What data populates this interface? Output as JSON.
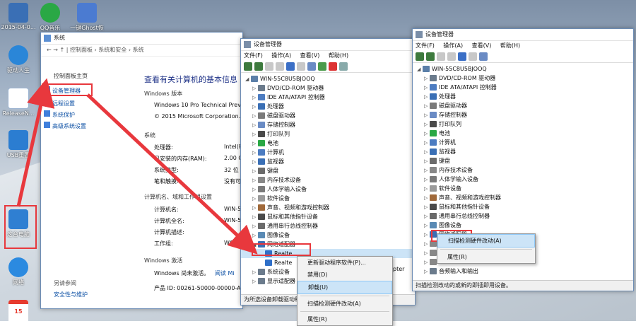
{
  "desktop": {
    "icons": [
      {
        "label": "2015-04-0...",
        "color": "#3a6fb5"
      },
      {
        "label": "QQ音乐",
        "color": "#28a745"
      },
      {
        "label": "一键Ghost恢复",
        "color": "#4b7bd1"
      },
      {
        "label": "驱动人生",
        "color": "#2a86d8"
      },
      {
        "label": "ReleaseN...",
        "color": "#9bb3d1"
      },
      {
        "label": "USB重置",
        "color": "#2b7dd1"
      },
      {
        "label": "这台电脑",
        "color": "#2f7fd2"
      },
      {
        "label": "网络",
        "color": "#2b8ae0"
      },
      {
        "label": "15",
        "color": "#e63b2e"
      }
    ]
  },
  "system_window": {
    "title": "系统",
    "breadcrumb": [
      "控制面板",
      "系统和安全",
      "系统"
    ],
    "left_links": {
      "home": "控制面板主页",
      "device_manager": "设备管理器",
      "remote": "远程设置",
      "protection": "系统保护",
      "advanced": "高级系统设置",
      "see_also": "另请参阅",
      "security": "安全性与维护"
    },
    "heading": "查看有关计算机的基本信息",
    "edition_label": "Windows 版本",
    "edition": "Windows 10 Pro Technical Previ",
    "copyright": "© 2015 Microsoft Corporation.",
    "system_section": "系统",
    "processor_label": "处理器:",
    "processor": "Intel(R",
    "memory_label": "已安装的内存(RAM):",
    "memory": "2.00 G",
    "type_label": "系统类型:",
    "type": "32 位",
    "pen_label": "笔和触摸:",
    "pen": "没有可",
    "computer_section": "计算机名、域和工作组设置",
    "name_label": "计算机名:",
    "name": "WIN-5",
    "fullname_label": "计算机全名:",
    "fullname": "WIN-5",
    "desc_label": "计算机描述:",
    "workgroup_label": "工作组:",
    "workgroup": "WORK",
    "activation_section": "Windows 激活",
    "activation_text": "Windows 尚未激活。",
    "activation_link": "阅读 Mi",
    "product_id": "产品 ID: 00261-50000-00000-AA"
  },
  "dm1": {
    "title": "设备管理器",
    "menu": [
      "文件(F)",
      "操作(A)",
      "查看(V)",
      "帮助(H)"
    ],
    "root": "WIN-55C8U5BJOOQ",
    "items": [
      "DVD/CD-ROM 驱动器",
      "IDE ATA/ATAPI 控制器",
      "处理器",
      "磁盘驱动器",
      "存储控制器",
      "打印队列",
      "电池",
      "计算机",
      "监视器",
      "键盘",
      "内存技术设备",
      "人体学输入设备",
      "软件设备",
      "声音、视频和游戏控制器",
      "鼠标和其他指针设备",
      "通用串行总线控制器",
      "图像设备",
      "网络适配器"
    ],
    "sub_items": [
      "Realte",
      "Realte"
    ],
    "after": [
      "系统设备",
      "显示适配器"
    ],
    "status": "为所选设备卸载驱动程序。",
    "context_menu": [
      "更新驱动程序软件(P)...",
      "禁用(D)",
      "卸载(U)",
      "扫描检测硬件改动(A)",
      "属性(R)"
    ],
    "realtek_tail": "pter"
  },
  "dm2": {
    "title": "设备管理器",
    "menu": [
      "文件(F)",
      "操作(A)",
      "查看(V)",
      "帮助(H)"
    ],
    "root": "WIN-55C8U5BJOOQ",
    "items": [
      "DVD/CD-ROM 驱动器",
      "IDE ATA/ATAPI 控制器",
      "处理器",
      "磁盘驱动器",
      "存储控制器",
      "打印队列",
      "电池",
      "计算机",
      "监视器",
      "键盘",
      "内存技术设备",
      "人体学输入设备",
      "软件设备",
      "声音、视频和游戏控制器",
      "鼠标和其他指针设备",
      "通用串行总线控制器",
      "图像设备",
      "网络适配器",
      "",
      "",
      "",
      "音频输入和输出"
    ],
    "status": "扫描检测改动的或新的即插即用设备。",
    "context_menu": [
      "扫描检测硬件改动(A)",
      "属性(R)"
    ]
  },
  "colors": {
    "highlight_red": "#e8383d",
    "select_blue": "#cce4f7"
  }
}
